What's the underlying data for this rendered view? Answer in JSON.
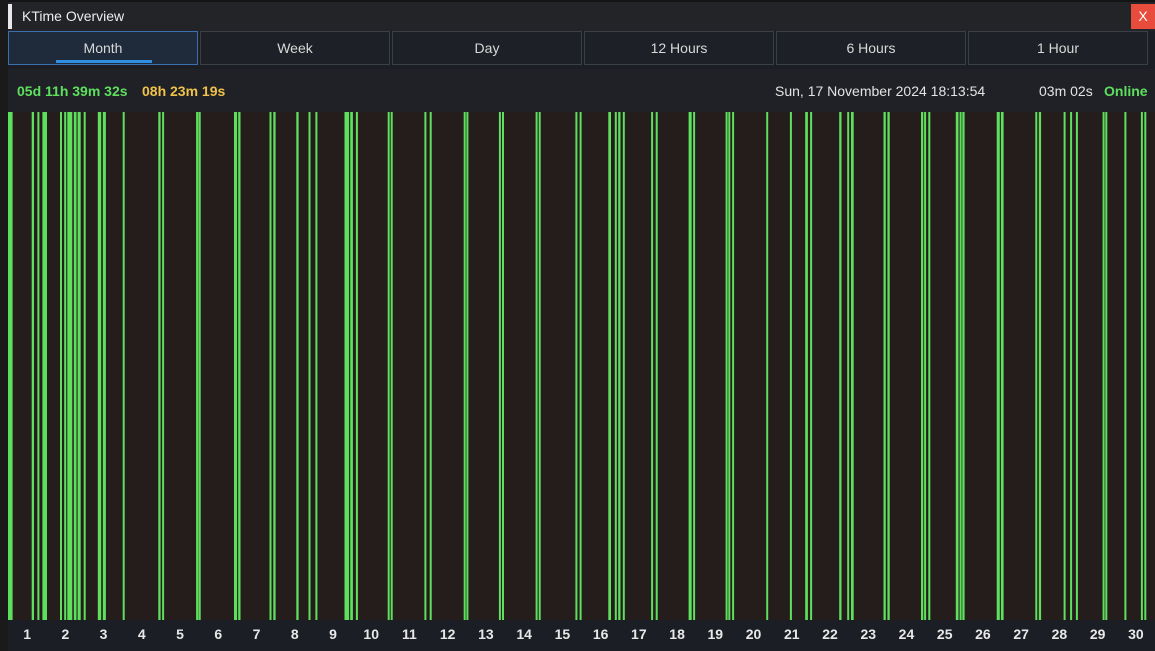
{
  "window": {
    "title": "KTime Overview",
    "close_label": "X"
  },
  "tabs": [
    {
      "label": "Month",
      "active": true
    },
    {
      "label": "Week",
      "active": false
    },
    {
      "label": "Day",
      "active": false
    },
    {
      "label": "12 Hours",
      "active": false
    },
    {
      "label": "6 Hours",
      "active": false
    },
    {
      "label": "1 Hour",
      "active": false
    }
  ],
  "info": {
    "total_time": "05d 11h 39m 32s",
    "offline_time": "08h 23m 19s",
    "datetime": "Sun, 17 November 2024 18:13:54",
    "session_time": "03m 02s",
    "status": "Online"
  },
  "colors": {
    "online": "#5ee05e",
    "offline_time": "#f0c24a",
    "chart_bg": "#251c1c",
    "active_tab_accent": "#2f8fe0",
    "close": "#e74c3c"
  },
  "chart_data": {
    "type": "timeline",
    "xlabel": "",
    "ylabel": "",
    "xlim": [
      0.5,
      30.5
    ],
    "categories": [
      "1",
      "2",
      "3",
      "4",
      "5",
      "6",
      "7",
      "8",
      "9",
      "10",
      "11",
      "12",
      "13",
      "14",
      "15",
      "16",
      "17",
      "18",
      "19",
      "20",
      "21",
      "22",
      "23",
      "24",
      "25",
      "26",
      "27",
      "28",
      "29",
      "30"
    ],
    "online_intervals": [
      [
        0.5,
        0.62
      ],
      [
        1.12,
        1.18
      ],
      [
        1.27,
        1.31
      ],
      [
        1.4,
        1.52
      ],
      [
        1.86,
        1.9
      ],
      [
        1.97,
        2.02
      ],
      [
        2.05,
        2.18
      ],
      [
        2.22,
        2.29
      ],
      [
        2.32,
        2.4
      ],
      [
        2.48,
        2.52
      ],
      [
        2.85,
        2.94
      ],
      [
        2.98,
        3.06
      ],
      [
        3.5,
        3.55
      ],
      [
        4.43,
        4.49
      ],
      [
        4.53,
        4.57
      ],
      [
        5.42,
        5.46
      ],
      [
        5.48,
        5.54
      ],
      [
        6.41,
        6.49
      ],
      [
        6.52,
        6.58
      ],
      [
        7.34,
        7.38
      ],
      [
        7.44,
        7.5
      ],
      [
        8.04,
        8.1
      ],
      [
        8.36,
        8.41
      ],
      [
        8.54,
        8.59
      ],
      [
        9.3,
        9.42
      ],
      [
        9.45,
        9.52
      ],
      [
        9.6,
        9.65
      ],
      [
        10.43,
        10.46
      ],
      [
        10.51,
        10.55
      ],
      [
        11.39,
        11.43
      ],
      [
        11.53,
        11.58
      ],
      [
        12.42,
        12.45
      ],
      [
        12.49,
        12.52
      ],
      [
        13.34,
        13.38
      ],
      [
        13.42,
        13.46
      ],
      [
        14.3,
        14.34
      ],
      [
        14.38,
        14.42
      ],
      [
        15.34,
        15.38
      ],
      [
        15.45,
        15.49
      ],
      [
        16.2,
        16.27
      ],
      [
        16.37,
        16.41
      ],
      [
        16.46,
        16.52
      ],
      [
        16.58,
        16.61
      ],
      [
        17.32,
        17.36
      ],
      [
        17.44,
        17.48
      ],
      [
        18.3,
        18.38
      ],
      [
        18.42,
        18.46
      ],
      [
        19.27,
        19.31
      ],
      [
        19.34,
        19.38
      ],
      [
        19.44,
        19.48
      ],
      [
        20.33,
        20.38
      ],
      [
        20.95,
        21.0
      ],
      [
        21.35,
        21.42
      ],
      [
        21.48,
        21.53
      ],
      [
        22.24,
        22.3
      ],
      [
        22.45,
        22.49
      ],
      [
        22.55,
        22.62
      ],
      [
        23.4,
        23.46
      ],
      [
        23.5,
        23.56
      ],
      [
        24.38,
        24.44
      ],
      [
        24.46,
        24.5
      ],
      [
        24.57,
        24.61
      ],
      [
        25.29,
        25.36
      ],
      [
        25.39,
        25.43
      ],
      [
        25.46,
        25.52
      ],
      [
        26.36,
        26.44
      ],
      [
        26.47,
        26.54
      ],
      [
        27.37,
        27.41
      ],
      [
        27.46,
        27.52
      ],
      [
        28.11,
        28.15
      ],
      [
        28.28,
        28.32
      ],
      [
        28.43,
        28.48
      ],
      [
        29.13,
        29.18
      ],
      [
        29.2,
        29.24
      ],
      [
        29.7,
        29.74
      ],
      [
        30.13,
        30.18
      ],
      [
        30.22,
        30.27
      ]
    ]
  }
}
